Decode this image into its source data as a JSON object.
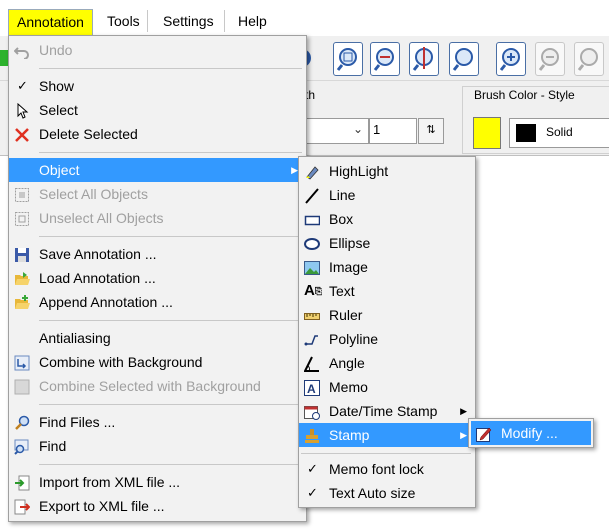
{
  "menubar": {
    "annotation": "Annotation",
    "tools": "Tools",
    "settings": "Settings",
    "help": "Help"
  },
  "options": {
    "width_label": "th",
    "width_value": "1",
    "brush_label": "Brush Color - Style",
    "brush_style": "Solid",
    "brush_color": "#ffff00"
  },
  "annotation_menu": {
    "undo": "Undo",
    "show": "Show",
    "select": "Select",
    "delete_selected": "Delete Selected",
    "object": "Object",
    "select_all_objects": "Select All Objects",
    "unselect_all_objects": "Unselect All Objects",
    "save_annotation": "Save Annotation ...",
    "load_annotation": "Load Annotation ...",
    "append_annotation": "Append Annotation ...",
    "antialiasing": "Antialiasing",
    "combine_background": "Combine with Background",
    "combine_selected_background": "Combine Selected with Background",
    "find_files": "Find Files ...",
    "find": "Find",
    "import_xml": "Import from XML file ...",
    "export_xml": "Export to XML file ..."
  },
  "object_menu": {
    "highlight": "HighLight",
    "line": "Line",
    "box": "Box",
    "ellipse": "Ellipse",
    "image": "Image",
    "text": "Text",
    "ruler": "Ruler",
    "polyline": "Polyline",
    "angle": "Angle",
    "memo": "Memo",
    "datetime_stamp": "Date/Time Stamp",
    "stamp": "Stamp",
    "memo_font_lock": "Memo font lock",
    "text_auto_size": "Text Auto size"
  },
  "stamp_menu": {
    "modify": "Modify ..."
  },
  "colors": {
    "highlight": "#3399ff",
    "active_menu": "#ffff00"
  }
}
